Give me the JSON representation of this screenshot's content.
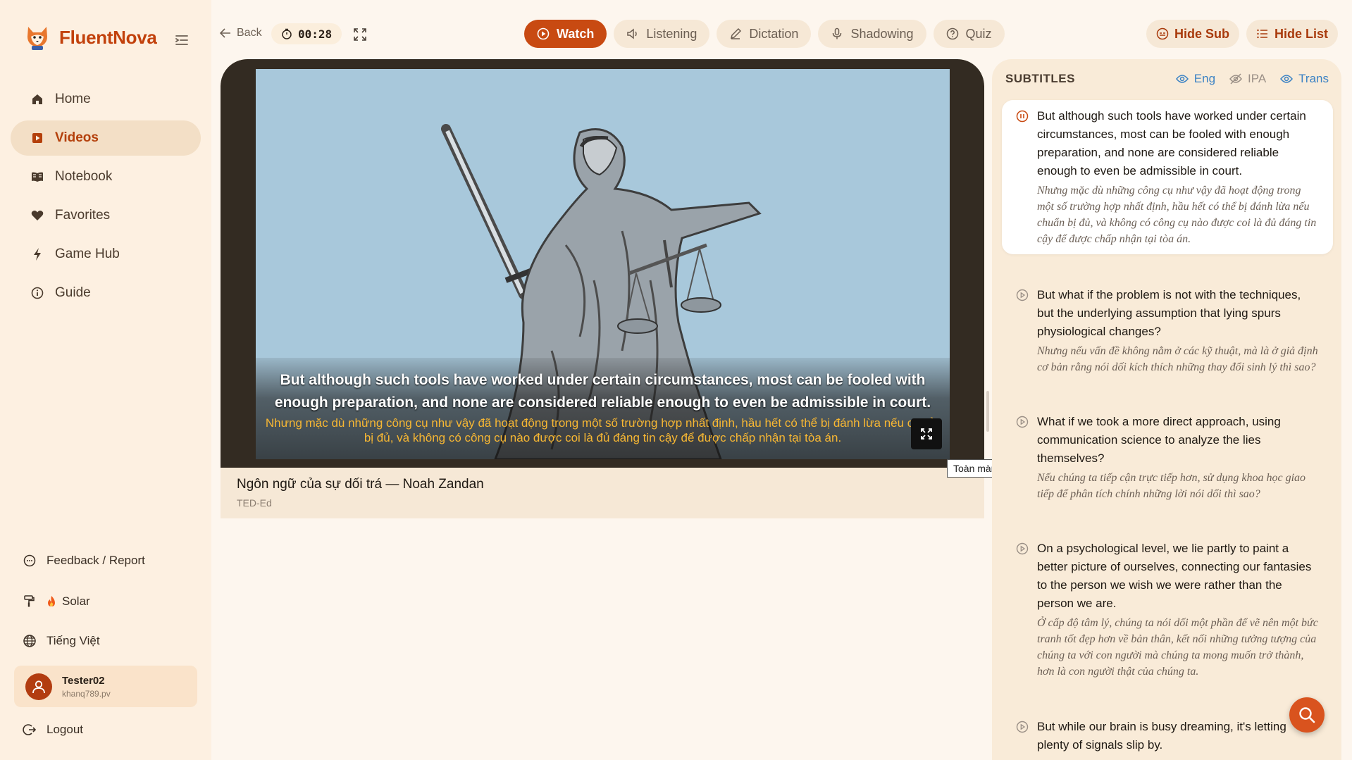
{
  "app": {
    "name": "FluentNova"
  },
  "sidebar": {
    "items": [
      {
        "label": "Home",
        "icon": "home-icon"
      },
      {
        "label": "Videos",
        "icon": "video-icon"
      },
      {
        "label": "Notebook",
        "icon": "notebook-icon"
      },
      {
        "label": "Favorites",
        "icon": "heart-icon"
      },
      {
        "label": "Game Hub",
        "icon": "lightning-icon"
      },
      {
        "label": "Guide",
        "icon": "info-icon"
      }
    ],
    "active": "Videos",
    "feedback_label": "Feedback / Report",
    "theme_label": "Solar",
    "language_label": "Tiếng Việt",
    "user": {
      "name": "Tester02",
      "email": "khanq789.pv"
    },
    "logout_label": "Logout"
  },
  "topbar": {
    "back_label": "Back",
    "timer": "00:28",
    "tabs": [
      {
        "label": "Watch",
        "icon": "play-circle-icon",
        "active": true
      },
      {
        "label": "Listening",
        "icon": "speaker-icon",
        "active": false
      },
      {
        "label": "Dictation",
        "icon": "pencil-icon",
        "active": false
      },
      {
        "label": "Shadowing",
        "icon": "microphone-icon",
        "active": false
      },
      {
        "label": "Quiz",
        "icon": "question-circle-icon",
        "active": false
      }
    ],
    "hide_sub_label": "Hide Sub",
    "hide_list_label": "Hide List"
  },
  "video": {
    "title": "Ngôn ngữ của sự dối trá — Noah Zandan",
    "channel": "TED-Ed",
    "subtitle_en": "But although such tools have worked under certain circumstances, most can be fooled with enough preparation, and none are considered reliable enough to even be admissible in court.",
    "subtitle_vi": "Nhưng mặc dù những công cụ như vậy đã hoạt động trong một số trường hợp nhất định, hầu hết có thể bị đánh lừa nếu chuẩn bị đủ, và không có công cụ nào được coi là đủ đáng tin cậy để được chấp nhận tại tòa án.",
    "fullscreen_tooltip": "Toàn màn hình"
  },
  "subtitles_panel": {
    "title": "SUBTITLES",
    "toggles": [
      {
        "label": "Eng",
        "on": true
      },
      {
        "label": "IPA",
        "on": false
      },
      {
        "label": "Trans",
        "on": true
      }
    ],
    "items": [
      {
        "en": "But although such tools have worked under certain circumstances, most can be fooled with enough preparation, and none are considered reliable enough to even be admissible in court.",
        "vi": "Nhưng mặc dù những công cụ như vậy đã hoạt động trong một số trường hợp nhất định, hầu hết có thể bị đánh lừa nếu chuẩn bị đủ, và không có công cụ nào được coi là đủ đáng tin cậy để được chấp nhận tại tòa án.",
        "active": true
      },
      {
        "en": "But what if the problem is not with the techniques, but the underlying assumption that lying spurs physiological changes?",
        "vi": "Nhưng nếu vấn đề không nằm ở các kỹ thuật, mà là ở giả định cơ bản rằng nói dối kích thích những thay đổi sinh lý thì sao?",
        "active": false
      },
      {
        "en": "What if we took a more direct approach, using communication science to analyze the lies themselves?",
        "vi": "Nếu chúng ta tiếp cận trực tiếp hơn, sử dụng khoa học giao tiếp để phân tích chính những lời nói dối thì sao?",
        "active": false
      },
      {
        "en": "On a psychological level, we lie partly to paint a better picture of ourselves, connecting our fantasies to the person we wish we were rather than the person we are.",
        "vi": "Ở cấp độ tâm lý, chúng ta nói dối một phần để vẽ nên một bức tranh tốt đẹp hơn về bản thân, kết nối những tưởng tượng của chúng ta với con người mà chúng ta mong muốn trở thành, hơn là con người thật của chúng ta.",
        "active": false
      },
      {
        "en": "But while our brain is busy dreaming, it's letting plenty of signals slip by.",
        "vi": "",
        "active": false
      }
    ]
  },
  "colors": {
    "accent": "#c84a12",
    "link_blue": "#3b82c4",
    "sidebar_bg": "#fdf0e1"
  }
}
